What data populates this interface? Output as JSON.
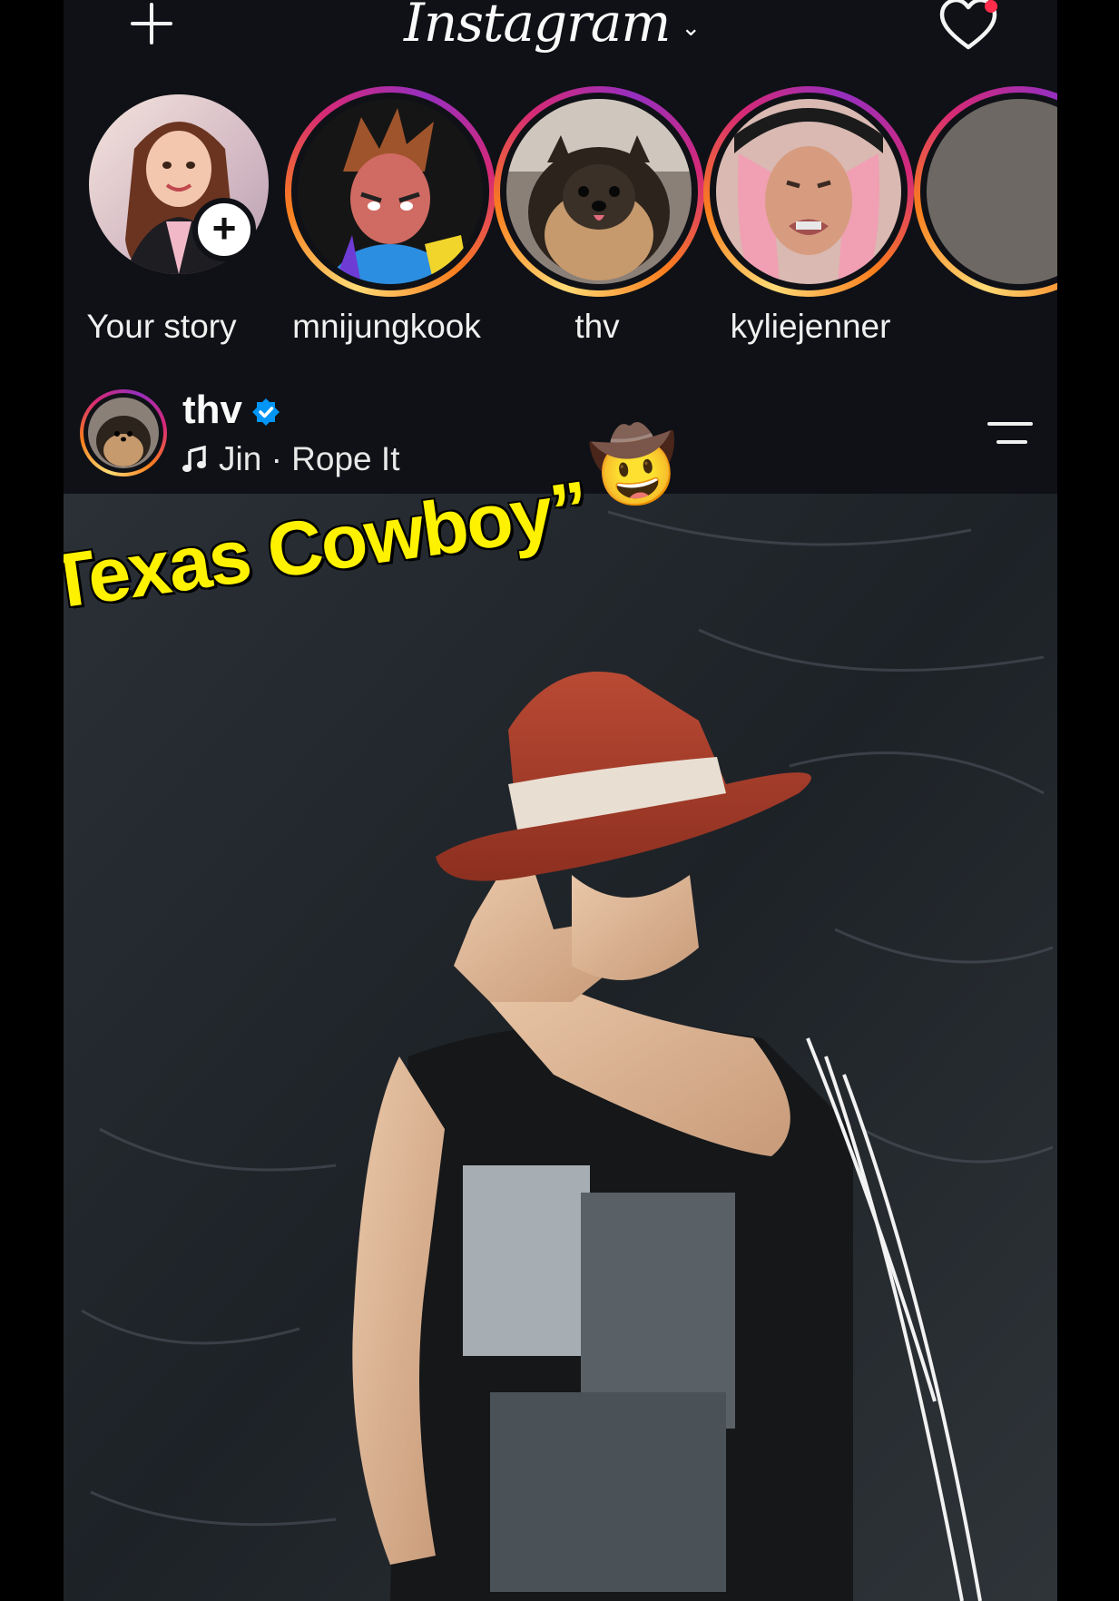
{
  "header": {
    "brand": "Instagram",
    "brand_chevron": "⌄",
    "left_icon": "plus-icon",
    "right_icon": "heart-icon",
    "has_notification": true
  },
  "stories": [
    {
      "label": "Your story",
      "is_own": true
    },
    {
      "label": "mnijungkook"
    },
    {
      "label": "thv"
    },
    {
      "label": "kyliejenner"
    }
  ],
  "post": {
    "username": "thv",
    "verified": true,
    "music": "Jin · Rope It",
    "overlay_caption": "“Texas Cowboy”",
    "overlay_emoji": "🤠"
  },
  "colors": {
    "background": "#0f1116",
    "story_ring_start": "#feda75",
    "story_ring_mid": "#d62976",
    "story_ring_end": "#962fbf",
    "caption_yellow": "#fff200",
    "verified_blue": "#0095f6"
  }
}
